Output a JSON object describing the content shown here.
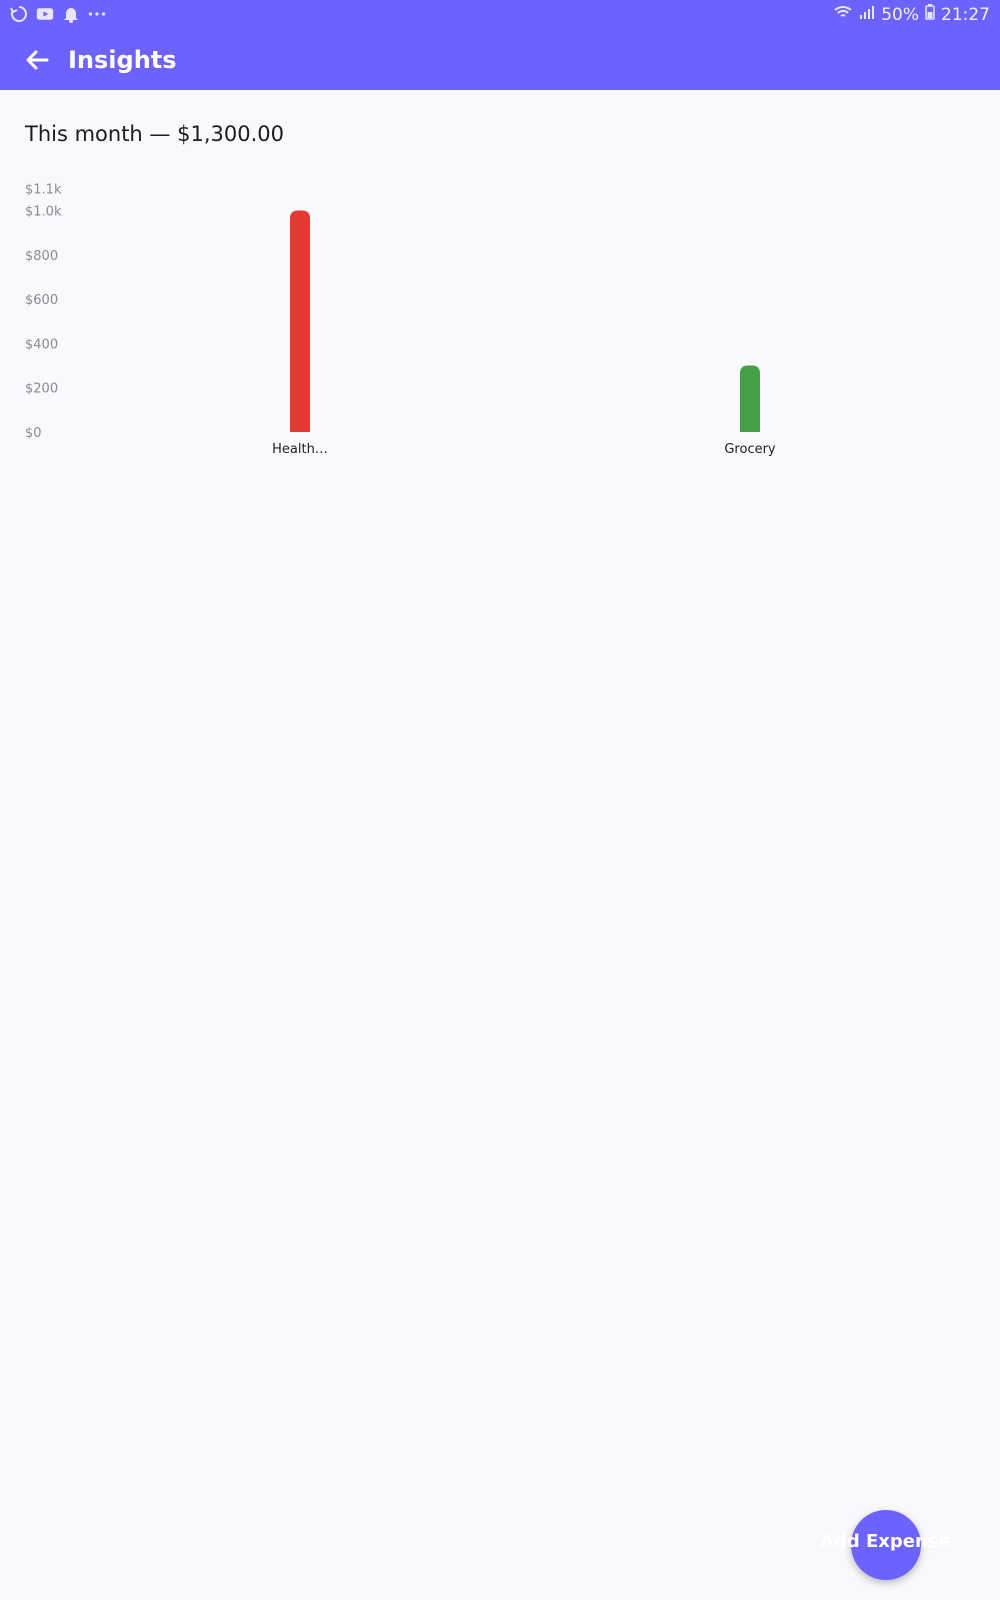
{
  "status_bar": {
    "left_icons": [
      "sync-icon",
      "youtube-icon",
      "notification-bell-icon",
      "more-dots-icon"
    ],
    "signal_icons": [
      "wifi-icon",
      "cell-signal-icon"
    ],
    "battery_percent": "50%",
    "time": "21:27"
  },
  "app_bar": {
    "title": "Insights",
    "back_icon": "arrow-left-icon",
    "background_color": "#6c63ff"
  },
  "summary": {
    "text": "This month — $1,300.00"
  },
  "chart_data": {
    "type": "bar",
    "categories": [
      "Health…",
      "Grocery"
    ],
    "values": [
      1000,
      300
    ],
    "colors": [
      "#e53935",
      "#43a047"
    ],
    "ylim": [
      0,
      1100
    ],
    "y_ticks": [
      {
        "value": 0,
        "label": "$0"
      },
      {
        "value": 200,
        "label": "$200"
      },
      {
        "value": 400,
        "label": "$400"
      },
      {
        "value": 600,
        "label": "$600"
      },
      {
        "value": 800,
        "label": "$800"
      },
      {
        "value": 1000,
        "label": "$1.0k"
      },
      {
        "value": 1100,
        "label": "$1.1k"
      }
    ],
    "grid": false
  },
  "fab": {
    "label": "Add Expense",
    "color": "#6c63ff"
  }
}
